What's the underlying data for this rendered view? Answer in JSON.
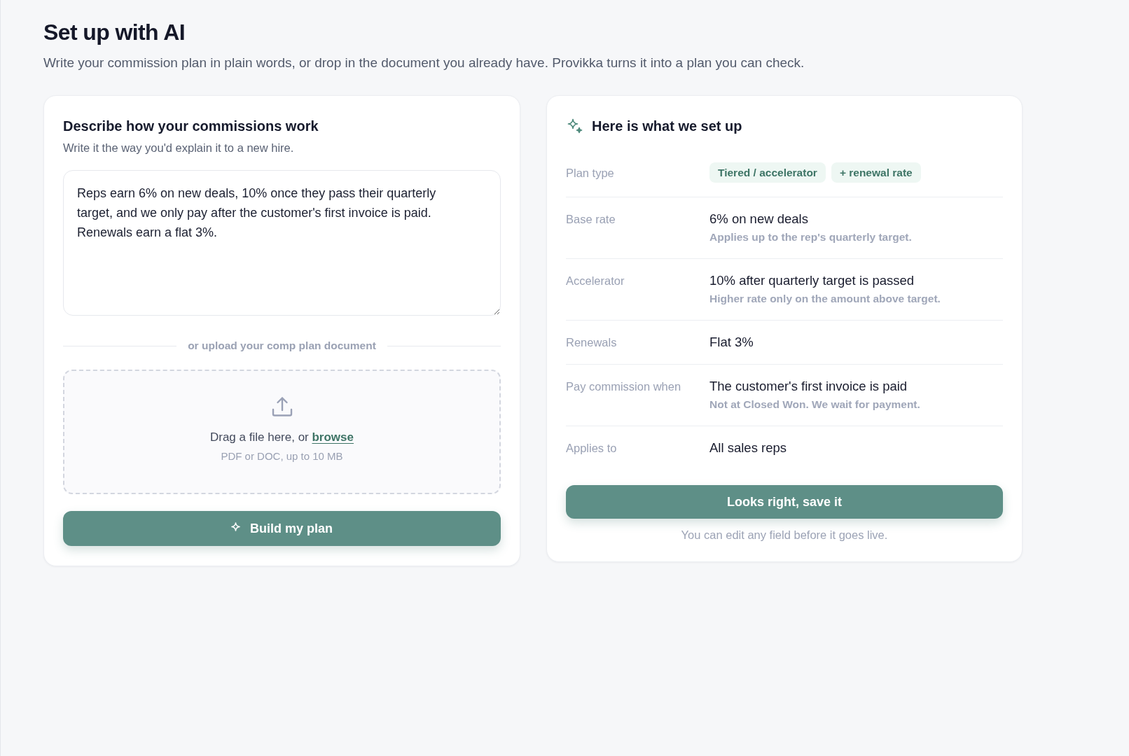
{
  "page": {
    "title": "Set up with AI",
    "subtitle": "Write your commission plan in plain words, or drop in the document you already have. Provikka turns it into a plan you can check."
  },
  "describe_card": {
    "title": "Describe how your commissions work",
    "hint": "Write it the way you'd explain it to a new hire.",
    "description": {
      "value": "Reps earn 6% on new deals, 10% once they pass their quarterly target, and we only pay after the customer's first invoice is paid. Renewals earn a flat 3%."
    },
    "divider_label": "or upload your comp plan document",
    "dropzone": {
      "prompt": "Drag a file here, or",
      "link": "browse",
      "note": "PDF or DOC, up to 10 MB"
    },
    "button": {
      "label": "Build my plan"
    }
  },
  "result_card": {
    "title": "Here is what we set up",
    "rows": [
      {
        "kind": "tags",
        "label": "Plan type",
        "tags": [
          "Tiered / accelerator",
          "+ renewal rate"
        ]
      },
      {
        "kind": "text",
        "label": "Base rate",
        "value": "6% on new deals",
        "note": "Applies up to the rep's quarterly target."
      },
      {
        "kind": "text",
        "label": "Accelerator",
        "value": "10% after quarterly target is passed",
        "note": "Higher rate only on the amount above target."
      },
      {
        "kind": "text",
        "label": "Renewals",
        "value": "Flat 3%"
      },
      {
        "kind": "text",
        "label": "Pay commission when",
        "value": "The customer's first invoice is paid",
        "note": "Not at Closed Won. We wait for payment."
      },
      {
        "kind": "text",
        "label": "Applies to",
        "value": "All sales reps"
      }
    ],
    "button": {
      "label": "Looks right, save it"
    },
    "footnote": "You can edit any field before it goes live."
  }
}
